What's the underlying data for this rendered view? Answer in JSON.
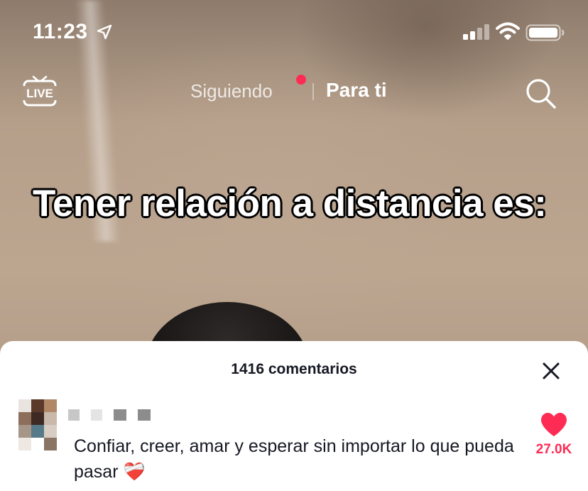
{
  "status_bar": {
    "time": "11:23",
    "location_icon": "location-arrow-icon",
    "signal_icon": "cellular-signal-icon",
    "wifi_icon": "wifi-icon",
    "battery_icon": "battery-icon"
  },
  "header": {
    "live_label": "LIVE",
    "tabs": [
      {
        "label": "Siguiendo",
        "active": false,
        "has_notification": true
      },
      {
        "label": "Para ti",
        "active": true
      }
    ],
    "search_icon": "search-icon"
  },
  "video": {
    "overlay_text": "Tener relación a distancia es:"
  },
  "comments": {
    "title": "1416 comentarios",
    "close_icon": "close-icon",
    "items": [
      {
        "text": "Confiar, creer, amar y esperar sin importar lo que pueda pasar",
        "emoji": "❤️‍🩹",
        "likes": "27.0K"
      }
    ]
  },
  "colors": {
    "accent": "#fe2c55",
    "text_dark": "#161823"
  }
}
